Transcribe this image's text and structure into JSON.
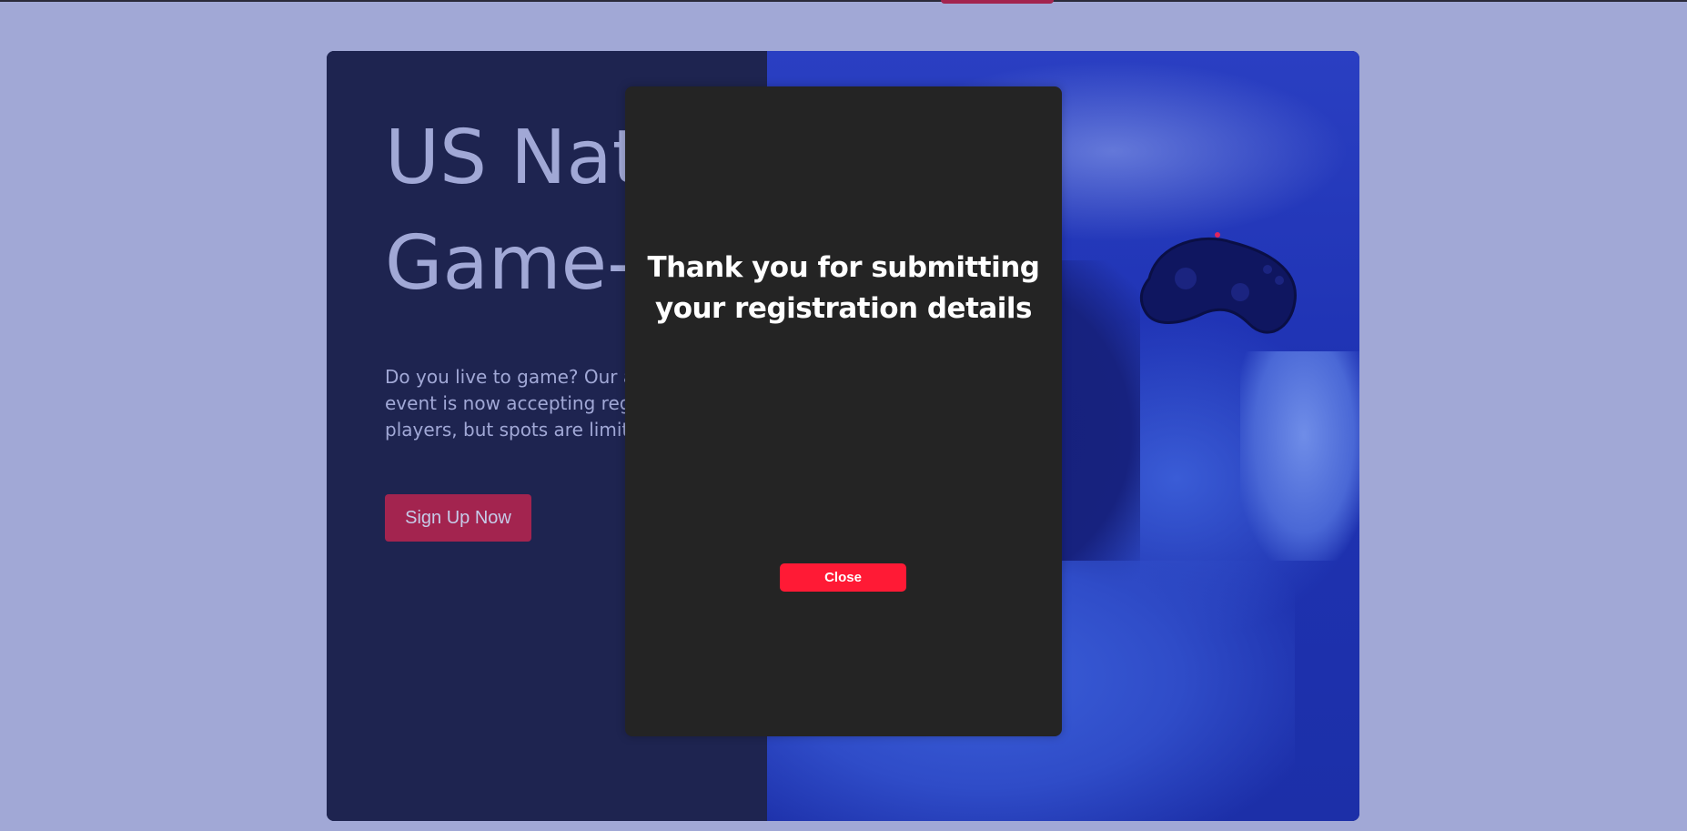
{
  "page": {
    "background_color": "#a1a8d6"
  },
  "hero": {
    "title": "US National\nGame-a-thon",
    "description": "Do you live to game? Our annual gaming event is now accepting registrations from players, but spots are limited.",
    "signup_label": "Sign Up Now",
    "panel_color": "#1e2450",
    "accent_color": "#a3244f",
    "image_icon": "gamer-with-controller-photo"
  },
  "modal": {
    "title": "Thank you for submitting your registration details",
    "close_label": "Close",
    "background_color": "#242424",
    "close_color": "#ff1a35"
  }
}
